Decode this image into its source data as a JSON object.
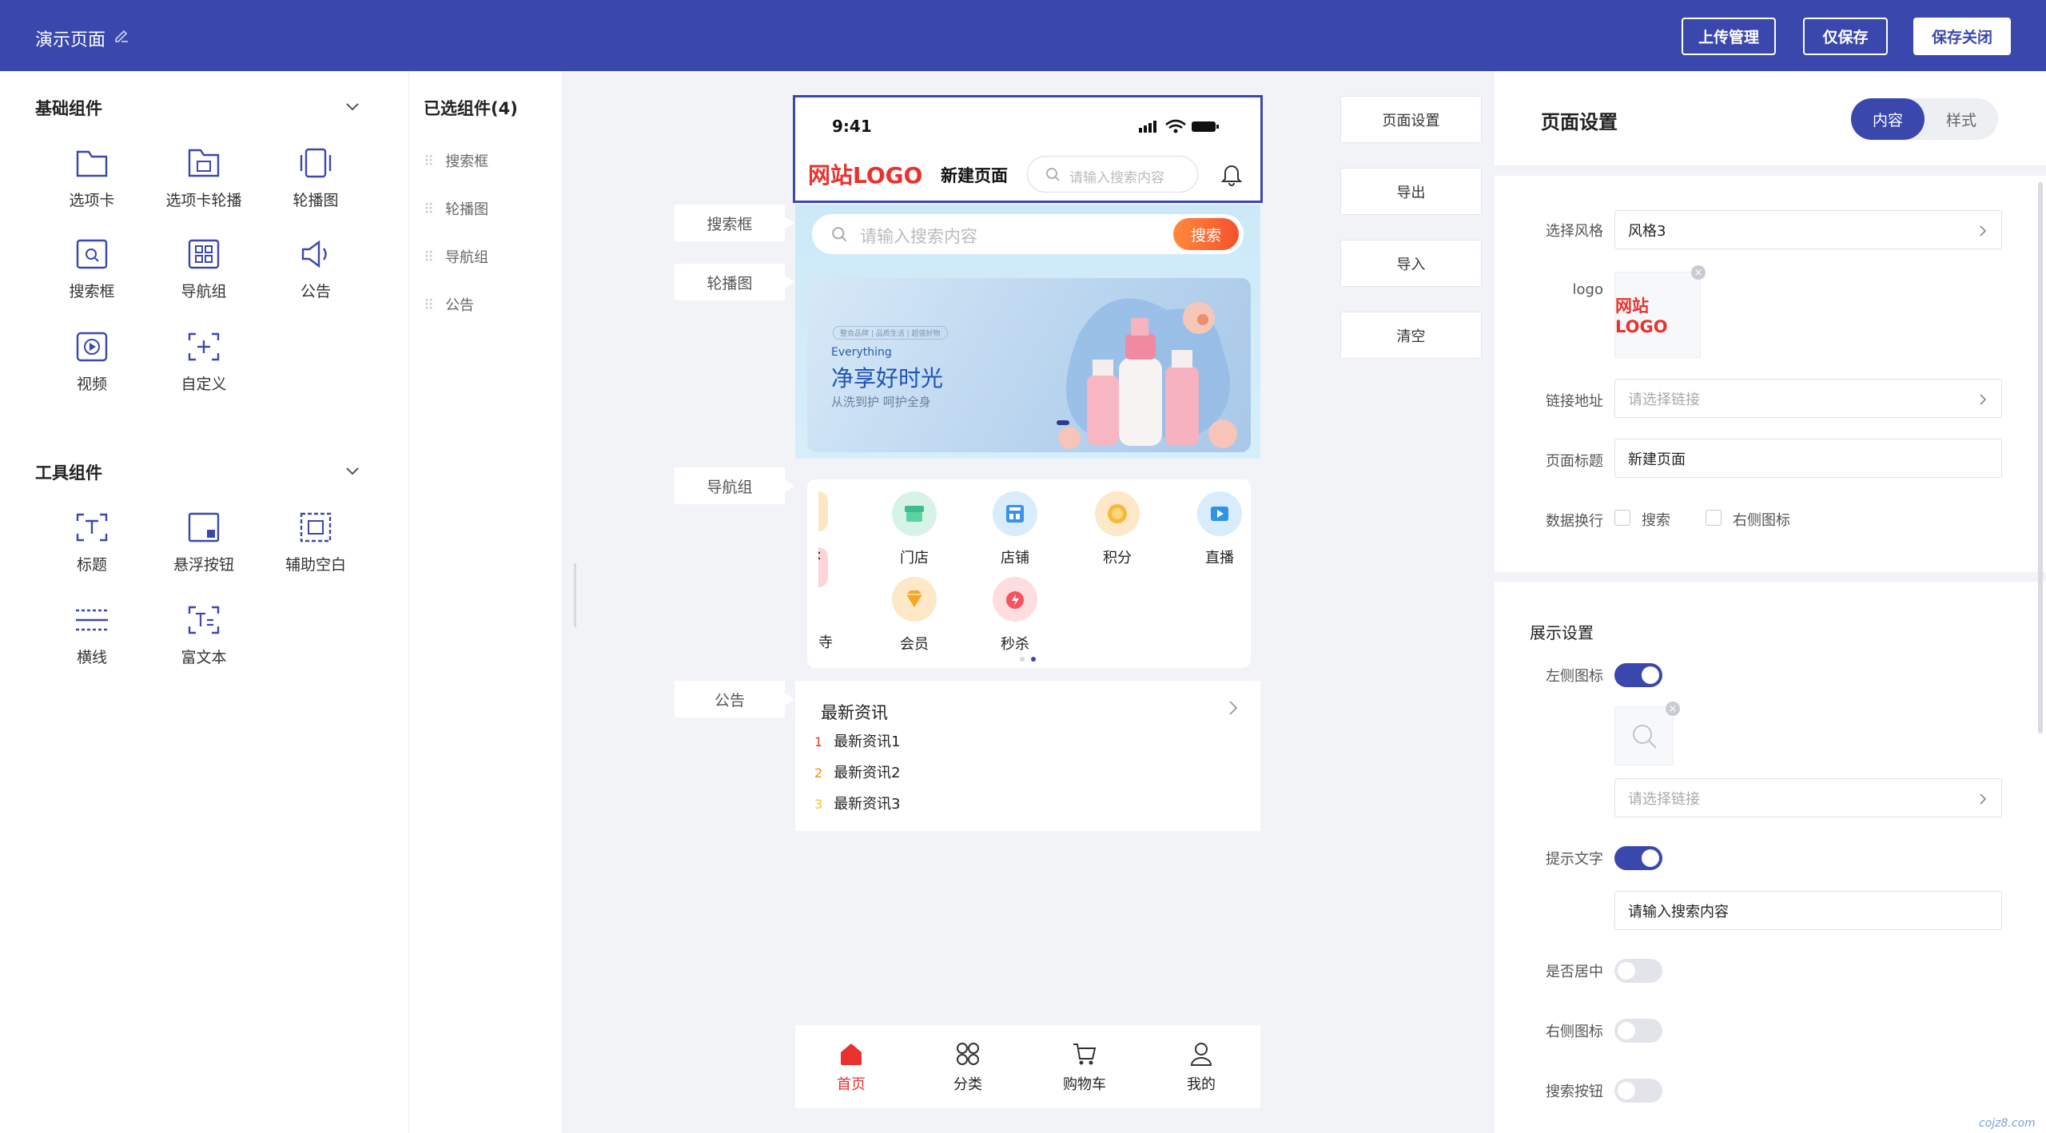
{
  "header": {
    "title": "演示页面",
    "buttons": {
      "upload": "上传管理",
      "save_only": "仅保存",
      "save_close": "保存关闭"
    }
  },
  "left_panel": {
    "basic_title": "基础组件",
    "basic_items": [
      "选项卡",
      "选项卡轮播",
      "轮播图",
      "搜索框",
      "导航组",
      "公告",
      "视频",
      "自定义"
    ],
    "tool_title": "工具组件",
    "tool_items": [
      "标题",
      "悬浮按钮",
      "辅助空白",
      "横线",
      "富文本"
    ]
  },
  "selected": {
    "title": "已选组件(4)",
    "items": [
      "搜索框",
      "轮播图",
      "导航组",
      "公告"
    ]
  },
  "canvas": {
    "tags": [
      "搜索框",
      "轮播图",
      "导航组",
      "公告"
    ],
    "side_buttons": [
      "页面设置",
      "导出",
      "导入",
      "清空"
    ]
  },
  "phone": {
    "time": "9:41",
    "logo": "网站LOGO",
    "page_title": "新建页面",
    "header_search_placeholder": "请输入搜索内容",
    "search_placeholder": "请输入搜索内容",
    "search_button": "搜索",
    "banner": {
      "tiny": "整合品牌 | 品质生活 | 超值好物",
      "en": "Everything",
      "title": "净享好时光",
      "sub": "从洗到护 呵护全身"
    },
    "nav_row1": [
      "门店",
      "店铺",
      "积分",
      "直播"
    ],
    "nav_row2": [
      "会员",
      "秒杀"
    ],
    "notice": {
      "title": "最新资讯",
      "items": [
        {
          "num": "1",
          "text": "最新资讯1",
          "color": "#e53935"
        },
        {
          "num": "2",
          "text": "最新资讯2",
          "color": "#fb8c00"
        },
        {
          "num": "3",
          "text": "最新资讯3",
          "color": "#fbc02d"
        }
      ]
    },
    "tabbar": [
      "首页",
      "分类",
      "购物车",
      "我的"
    ]
  },
  "right_panel": {
    "title": "页面设置",
    "tabs": [
      "内容",
      "样式"
    ],
    "style_label": "选择风格",
    "style_value": "风格3",
    "logo_label": "logo",
    "logo_text": "网站LOGO",
    "link_label": "链接地址",
    "link_placeholder": "请选择链接",
    "page_title_label": "页面标题",
    "page_title_value": "新建页面",
    "wrap_label": "数据换行",
    "wrap_opts": [
      "搜索",
      "右侧图标"
    ],
    "display_title": "展示设置",
    "left_icon_label": "左侧图标",
    "left_icon_on": true,
    "left_link_placeholder": "请选择链接",
    "hint_label": "提示文字",
    "hint_on": true,
    "hint_value": "请输入搜索内容",
    "center_label": "是否居中",
    "center_on": false,
    "right_icon_label": "右侧图标",
    "right_icon_on": false,
    "search_btn_label": "搜索按钮",
    "search_btn_on": false
  },
  "watermark": "cojz8.com"
}
